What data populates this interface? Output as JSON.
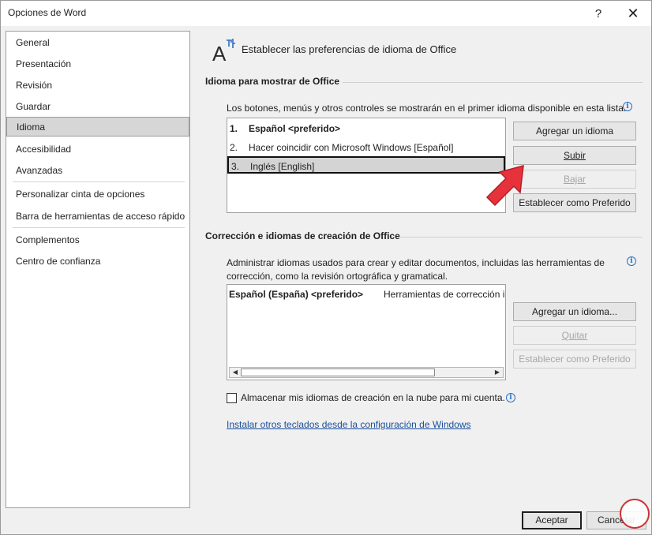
{
  "window": {
    "title": "Opciones de Word",
    "help_glyph": "?",
    "close_glyph": "✕"
  },
  "sidebar": {
    "items": [
      {
        "label": "General"
      },
      {
        "label": "Presentación"
      },
      {
        "label": "Revisión"
      },
      {
        "label": "Guardar"
      },
      {
        "label": "Idioma"
      },
      {
        "label": "Accesibilidad"
      },
      {
        "label": "Avanzadas"
      },
      {
        "label": "Personalizar cinta de opciones"
      },
      {
        "label": "Barra de herramientas de acceso rápido"
      },
      {
        "label": "Complementos"
      },
      {
        "label": "Centro de confianza"
      }
    ],
    "selected": "Idioma"
  },
  "header": {
    "text": "Establecer las preferencias de idioma de Office"
  },
  "display_section": {
    "title": "Idioma para mostrar de Office",
    "description": "Los botones, menús y otros controles se mostrarán en el primer idioma disponible en esta lista.",
    "languages": [
      {
        "num": "1.",
        "label": "Español <preferido>"
      },
      {
        "num": "2.",
        "label": "Hacer coincidir con Microsoft Windows [Español]"
      },
      {
        "num": "3.",
        "label": "Inglés [English]"
      }
    ],
    "buttons": {
      "add": "Agregar un idioma",
      "up": "Subir",
      "down": "Bajar",
      "set_preferred": "Establecer como Preferido"
    }
  },
  "authoring_section": {
    "title": "Corrección e idiomas de creación de Office",
    "description_line1": "Administrar idiomas usados para crear y editar documentos, incluidas las herramientas de",
    "description_line2": "corrección, como la revisión ortográfica y gramatical.",
    "rows": [
      {
        "language": "Español (España) <preferido>",
        "tools": "Herramientas de corrección instaladas"
      }
    ],
    "buttons": {
      "add": "Agregar un idioma...",
      "remove": "Quitar",
      "set_preferred": "Establecer como Preferido"
    },
    "checkbox_label": "Almacenar mis idiomas de creación en la nube para mi cuenta.",
    "checkbox_checked": false,
    "link": "Instalar otros teclados desde la configuración de Windows"
  },
  "footer": {
    "ok": "Aceptar",
    "cancel": "Cancelar"
  },
  "colors": {
    "accent_arrow": "#e8323b",
    "link": "#1a4f9c",
    "info": "#2b6fc4"
  },
  "icons": {
    "header": "language-icon",
    "info": "info-icon",
    "scroll_left": "◀",
    "scroll_right": "▶"
  }
}
